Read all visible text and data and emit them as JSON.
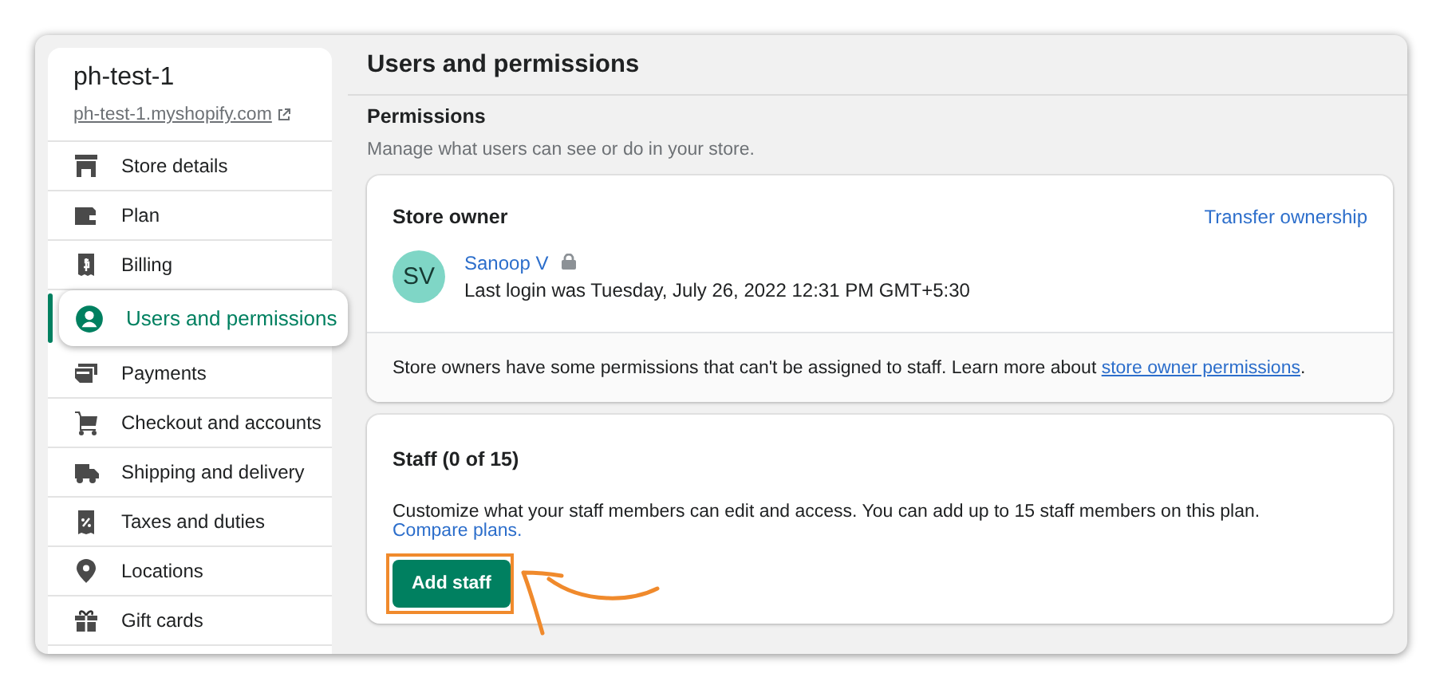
{
  "sidebar": {
    "store_name": "ph-test-1",
    "store_url": "ph-test-1.myshopify.com",
    "items": [
      {
        "label": "Store details",
        "selected": false
      },
      {
        "label": "Plan",
        "selected": false
      },
      {
        "label": "Billing",
        "selected": false
      },
      {
        "label": "Users and permissions",
        "selected": true
      },
      {
        "label": "Payments",
        "selected": false
      },
      {
        "label": "Checkout and accounts",
        "selected": false
      },
      {
        "label": "Shipping and delivery",
        "selected": false
      },
      {
        "label": "Taxes and duties",
        "selected": false
      },
      {
        "label": "Locations",
        "selected": false
      },
      {
        "label": "Gift cards",
        "selected": false
      }
    ]
  },
  "page": {
    "title": "Users and permissions",
    "section_title": "Permissions",
    "section_subtitle": "Manage what users can see or do in your store.",
    "owner_card": {
      "title": "Store owner",
      "action": "Transfer ownership",
      "owner": {
        "initials": "SV",
        "name": "Sanoop V",
        "locked": true,
        "last_login": "Last login was Tuesday, July 26, 2022 12:31 PM GMT+5:30"
      },
      "note": "Store owners have some permissions that can't be assigned to staff. Learn more about ",
      "note_link": "store owner permissions",
      "note_end": "."
    },
    "staff_card": {
      "title": "Staff (0 of 15)",
      "text": "Customize what your staff members can edit and access. You can add up to 15 staff members on this plan. ",
      "link": "Compare plans.",
      "button": "Add staff",
      "highlighted": true
    }
  }
}
